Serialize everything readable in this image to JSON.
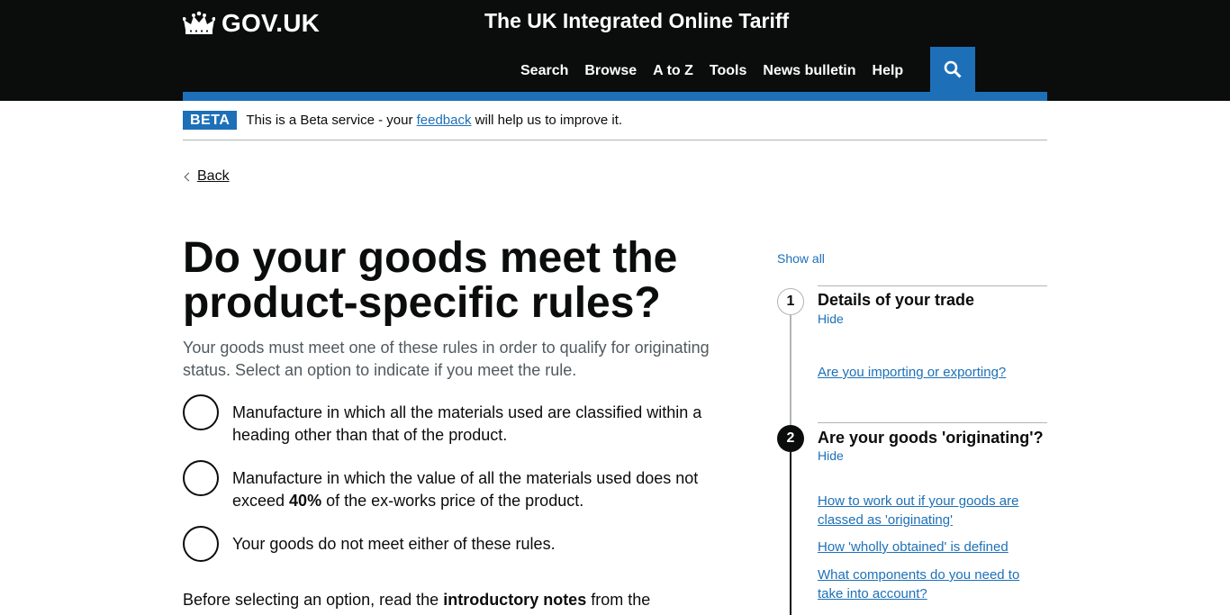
{
  "header": {
    "logo_text": "GOV.UK",
    "service_name": "The UK Integrated Online Tariff",
    "nav": [
      "Search",
      "Browse",
      "A to Z",
      "Tools",
      "News bulletin",
      "Help"
    ]
  },
  "phase_banner": {
    "tag": "BETA",
    "text_before": "This is a Beta service - your ",
    "link": "feedback",
    "text_after": " will help us to improve it."
  },
  "back_link": "Back",
  "main": {
    "title": "Do your goods meet the product-specific rules?",
    "lead": "Your goods must meet one of these rules in order to qualify for originating status. Select an option to indicate if you meet the rule.",
    "options": [
      {
        "label": "Manufacture in which all the materials used are classified within a heading other than that of the product."
      },
      {
        "label_before": "Manufacture in which the value of all the materials used does not exceed ",
        "label_bold": "40%",
        "label_after": " of the ex-works price of the product."
      },
      {
        "label": "Your goods do not meet either of these rules."
      }
    ],
    "bottom_before": "Before selecting an option, read the ",
    "bottom_bold": "introductory notes",
    "bottom_after": " from the"
  },
  "step_nav": {
    "show_all": "Show all",
    "steps": [
      {
        "number": "1",
        "title": "Details of your trade",
        "toggle": "Hide",
        "links": [
          "Are you importing or exporting?"
        ]
      },
      {
        "number": "2",
        "title": "Are your goods 'originating'?",
        "toggle": "Hide",
        "links": [
          "How to work out if your goods are classed as 'originating'",
          "How 'wholly obtained' is defined",
          "What components do you need to take into account?"
        ]
      }
    ]
  },
  "colors": {
    "header_bg": "#0b0c0c",
    "brand_blue": "#1d70b8",
    "secondary_text": "#505a5f",
    "border": "#b1b4b6"
  }
}
